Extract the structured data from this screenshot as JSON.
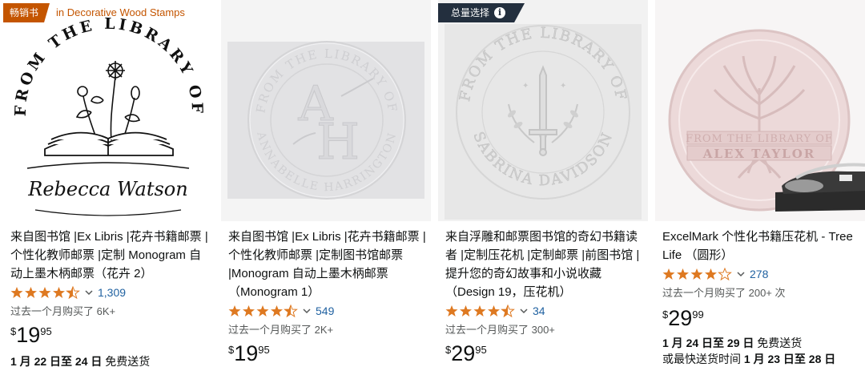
{
  "products": [
    {
      "badge": "畅销书",
      "badge_category": "in Decorative Wood Stamps",
      "image_text": {
        "arc": "FROM THE LIBRARY OF",
        "name": "Rebecca Watson"
      },
      "title": "来自图书馆 |Ex Libris |花卉书籍邮票 |个性化教师邮票 |定制 Monogram 自动上墨木柄邮票（花卉 2）",
      "rating": 4.5,
      "rating_count": "1,309",
      "bought": "过去一个月购买了 6K+",
      "price_symbol": "$",
      "price_whole": "19",
      "price_fraction": "95",
      "delivery_dates": "1 月 22 日至 24 日",
      "delivery_note": "免费送货"
    },
    {
      "image_text": {
        "arc_top": "FROM THE LIBRARY OF",
        "arc_bottom": "ANNABELLE HARRINGTON",
        "monogram_a": "A",
        "monogram_h": "H"
      },
      "title": "来自图书馆 |Ex Libris |花卉书籍邮票 |个性化教师邮票 |定制图书馆邮票 |Monogram 自动上墨木柄邮票（Monogram 1）",
      "rating": 4.5,
      "rating_count": "549",
      "bought": "过去一个月购买了 2K+",
      "price_symbol": "$",
      "price_whole": "19",
      "price_fraction": "95"
    },
    {
      "badge": "总量选择",
      "image_text": {
        "arc_top": "FROM THE LIBRARY OF",
        "arc_bottom": "SABRINA DAVIDSON"
      },
      "title": "来自浮雕和邮票图书馆的奇幻书籍读者 |定制压花机 |定制邮票 |前图书馆 |提升您的奇幻故事和小说收藏（Design 19，压花机）",
      "rating": 4.5,
      "rating_count": "34",
      "bought": "过去一个月购买了 300+",
      "price_symbol": "$",
      "price_whole": "29",
      "price_fraction": "95"
    },
    {
      "image_text": {
        "banner_top": "FROM THE LIBRARY OF",
        "banner_name": "ALEX TAYLOR"
      },
      "title": "ExcelMark 个性化书籍压花机 - Tree Life （圆形）",
      "rating": 4.0,
      "rating_count": "278",
      "bought": "过去一个月购买了 200+ 次",
      "price_symbol": "$",
      "price_whole": "29",
      "price_fraction": "99",
      "delivery_dates": "1 月 24 日至 29 日",
      "delivery_note": "免费送货",
      "delivery_fast_prefix": "或最快送货时间",
      "delivery_fast_dates": "1 月 23 日至 28 日"
    }
  ],
  "colors": {
    "star": "#de7921",
    "link": "#2162a1",
    "best_seller": "#c45500",
    "choice": "#232f3e"
  }
}
